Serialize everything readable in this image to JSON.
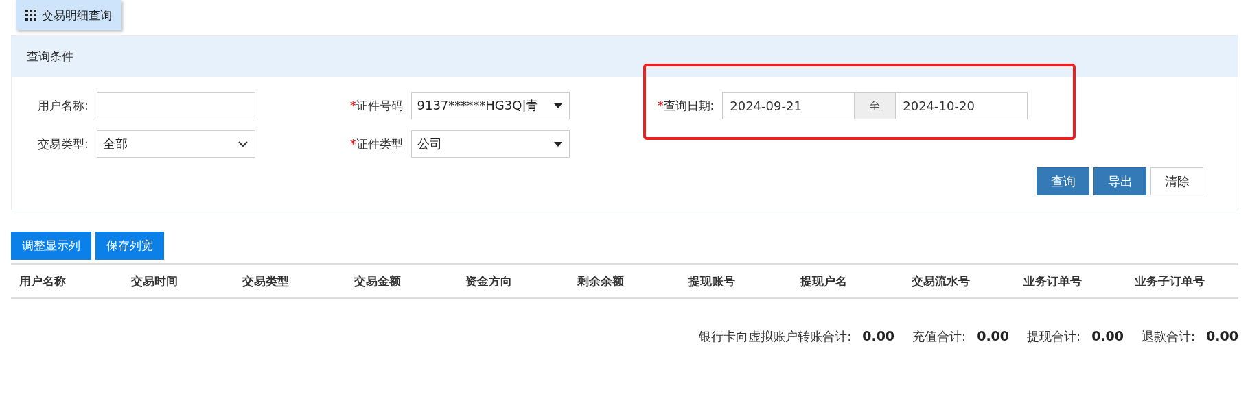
{
  "tab": {
    "label": "交易明细查询",
    "selected": true
  },
  "panel": {
    "title": "查询条件"
  },
  "fields": [
    {
      "kind": "input",
      "label": "用户名称:"
    },
    {
      "kind": "select",
      "marker": "*",
      "label": "证件号码",
      "value": "9137******HG3Q|青"
    },
    {
      "kind": "daterange",
      "marker": "*",
      "label": "查询日期:",
      "from": "2024-09-21",
      "separator": "至",
      "to": "2024-10-20",
      "highlighted": true
    },
    {
      "kind": "dropdown",
      "label": "交易类型:",
      "value": "全部"
    },
    {
      "kind": "select",
      "marker": "*",
      "label": "证件类型",
      "value": "公司"
    }
  ],
  "actions": [
    {
      "label": "查询",
      "primary": true
    },
    {
      "label": "导出",
      "primary": true
    },
    {
      "label": "清除",
      "primary": false
    }
  ],
  "toolbar": [
    "调整显示列",
    "保存列宽"
  ],
  "table": {
    "columns": [
      "用户名称",
      "交易时间",
      "交易类型",
      "交易金额",
      "资金方向",
      "剩余余额",
      "提现账号",
      "提现户名",
      "交易流水号",
      "业务订单号",
      "业务子订单号"
    ]
  },
  "totals": [
    {
      "label": "银行卡向虚拟账户转账合计:",
      "value": "0.00"
    },
    {
      "label": "充值合计:",
      "value": "0.00"
    },
    {
      "label": "提现合计:",
      "value": "0.00"
    },
    {
      "label": "退款合计:",
      "value": "0.00"
    }
  ]
}
